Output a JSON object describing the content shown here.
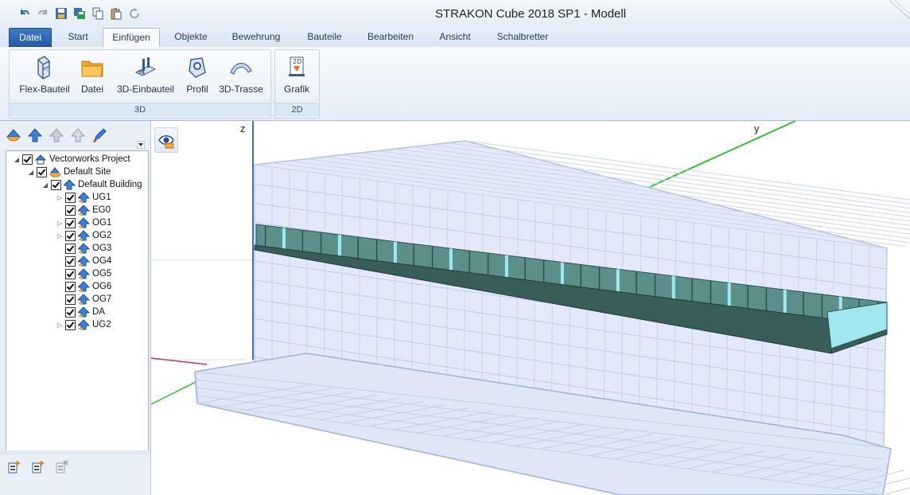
{
  "window": {
    "title": "STRAKON Cube 2018 SP1 - Modell"
  },
  "quick_access": [
    {
      "icon": "undo-icon"
    },
    {
      "icon": "redo-icon"
    },
    {
      "icon": "save-icon"
    },
    {
      "icon": "save-all-icon"
    },
    {
      "icon": "copy-icon"
    },
    {
      "icon": "paste-icon"
    },
    {
      "icon": "refresh-icon"
    }
  ],
  "tabs": [
    {
      "label": "Datei"
    },
    {
      "label": "Start"
    },
    {
      "label": "Einfügen"
    },
    {
      "label": "Objekte"
    },
    {
      "label": "Bewehrung"
    },
    {
      "label": "Bauteile"
    },
    {
      "label": "Bearbeiten"
    },
    {
      "label": "Ansicht"
    },
    {
      "label": "Schalbretter"
    }
  ],
  "active_tab": "Einfügen",
  "ribbon": {
    "group_3d": {
      "label": "3D",
      "buttons": [
        {
          "label": "Flex-Bauteil",
          "icon": "flex-component-icon"
        },
        {
          "label": "Datei",
          "icon": "folder-icon"
        },
        {
          "label": "3D-Einbauteil",
          "icon": "embedded-part-icon"
        },
        {
          "label": "Profil",
          "icon": "profile-icon"
        },
        {
          "label": "3D-Trasse",
          "icon": "route-icon"
        }
      ]
    },
    "group_2d": {
      "label": "2D",
      "buttons": [
        {
          "label": "Grafik",
          "icon": "graphic-2d-icon"
        }
      ],
      "badge": "2D"
    }
  },
  "tree": {
    "project": "Vectorworks Project",
    "site": "Default Site",
    "building": "Default Building",
    "stories": [
      {
        "label": "UG1",
        "expandable": true
      },
      {
        "label": "EG0",
        "expandable": false
      },
      {
        "label": "OG1",
        "expandable": true
      },
      {
        "label": "OG2",
        "expandable": true
      },
      {
        "label": "OG3",
        "expandable": false
      },
      {
        "label": "OG4",
        "expandable": false
      },
      {
        "label": "OG5",
        "expandable": false
      },
      {
        "label": "OG6",
        "expandable": false
      },
      {
        "label": "OG7",
        "expandable": false
      },
      {
        "label": "DA",
        "expandable": false
      },
      {
        "label": "UG2",
        "expandable": true
      }
    ]
  },
  "viewport": {
    "axis_z": "z",
    "axis_y": "y"
  },
  "colors": {
    "accent": "#2b5fa8",
    "slab": "#4e8c86",
    "wire": "#c8d4ec",
    "axis_z": "#3b6fd6",
    "axis_y": "#2fc22f",
    "axis_x": "#c0307a"
  }
}
